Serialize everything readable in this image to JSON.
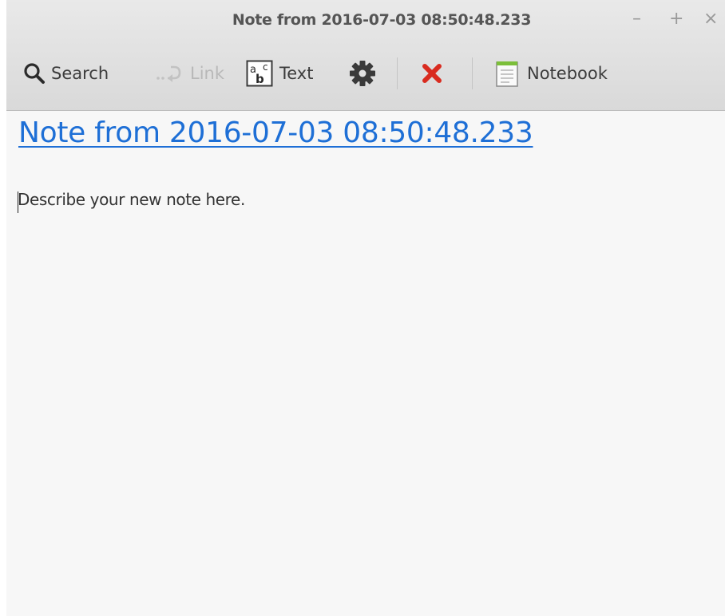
{
  "window": {
    "title": "Note from 2016-07-03 08:50:48.233",
    "minimize_glyph": "–",
    "maximize_glyph": "+",
    "close_glyph": "×"
  },
  "toolbar": {
    "search_label": "Search",
    "link_label": "Link",
    "text_label": "Text",
    "notebook_label": "Notebook",
    "icons": [
      "search-icon",
      "link-icon",
      "text-format-icon",
      "gear-icon",
      "delete-icon",
      "notebook-icon"
    ],
    "delete_color": "#d92b1f"
  },
  "note": {
    "title": "Note from 2016-07-03 08:50:48.233",
    "body": "Describe your new note here.",
    "link_color": "#1e6fd6"
  }
}
